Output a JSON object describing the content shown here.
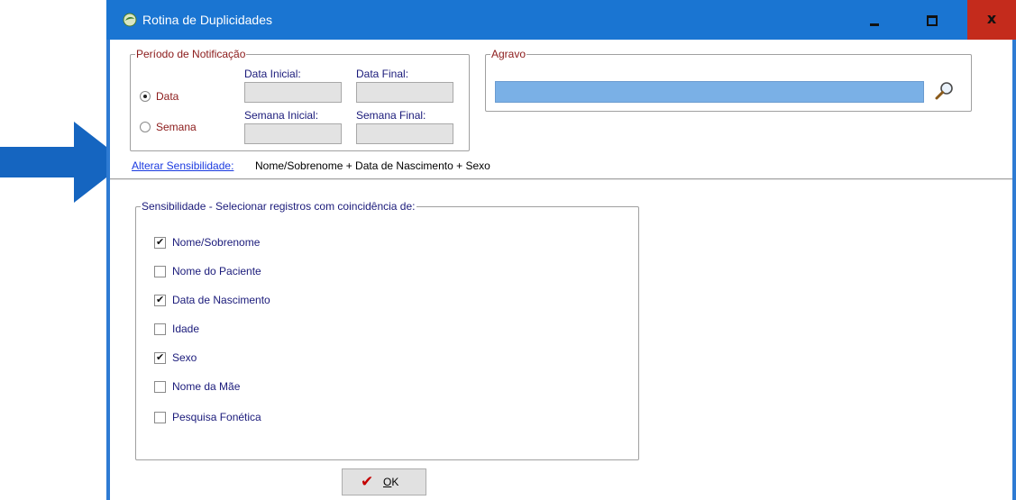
{
  "window": {
    "title": "Rotina de Duplicidades",
    "close_glyph": "x"
  },
  "periodo": {
    "title": "Período de Notificação",
    "radio_data": "Data",
    "radio_semana": "Semana",
    "selected": "Data",
    "data_inicial_label": "Data Inicial:",
    "data_final_label": "Data Final:",
    "semana_inicial_label": "Semana Inicial:",
    "semana_final_label": "Semana Final:",
    "data_inicial_value": "",
    "data_final_value": "",
    "semana_inicial_value": "",
    "semana_final_value": ""
  },
  "agravo": {
    "title": "Agravo",
    "value": ""
  },
  "sensibilidade": {
    "link_label": "Alterar Sensibilidade:",
    "current": "Nome/Sobrenome + Data de Nascimento + Sexo",
    "group_title": "Sensibilidade - Selecionar registros com coincidência de:",
    "options": [
      {
        "label": "Nome/Sobrenome",
        "checked": true
      },
      {
        "label": "Nome do Paciente",
        "checked": false
      },
      {
        "label": "Data de Nascimento",
        "checked": true
      },
      {
        "label": "Idade",
        "checked": false
      },
      {
        "label": "Sexo",
        "checked": true
      },
      {
        "label": "Nome da Mãe",
        "checked": false
      },
      {
        "label": "Pesquisa Fonética",
        "checked": false
      }
    ]
  },
  "ok_button": {
    "label_accel": "O",
    "label_rest": "K"
  },
  "colors": {
    "title_bar": "#1a75d2",
    "close_button": "#c42b1c",
    "arrow": "#1565c0",
    "agravo_field": "#7ab0e6"
  },
  "icons": [
    "app-icon",
    "minimize-icon",
    "maximize-icon",
    "close-icon",
    "search-icon",
    "checkmark-icon",
    "arrow-right-icon"
  ]
}
